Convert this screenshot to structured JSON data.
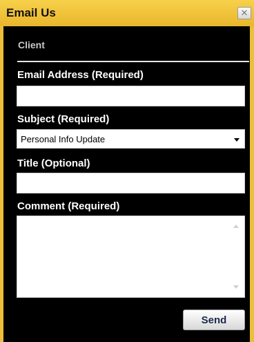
{
  "dialog": {
    "title": "Email Us",
    "close_glyph": "✕",
    "section_label": "Client"
  },
  "form": {
    "email": {
      "label": "Email Address (Required)",
      "value": ""
    },
    "subject": {
      "label": "Subject (Required)",
      "selected": "Personal Info Update"
    },
    "title_field": {
      "label": "Title (Optional)",
      "value": ""
    },
    "comment": {
      "label": "Comment (Required)",
      "value": ""
    },
    "send_label": "Send"
  },
  "colors": {
    "frame_accent": "#ecbf3a",
    "panel_background": "#000000",
    "label_text": "#ffffff"
  }
}
